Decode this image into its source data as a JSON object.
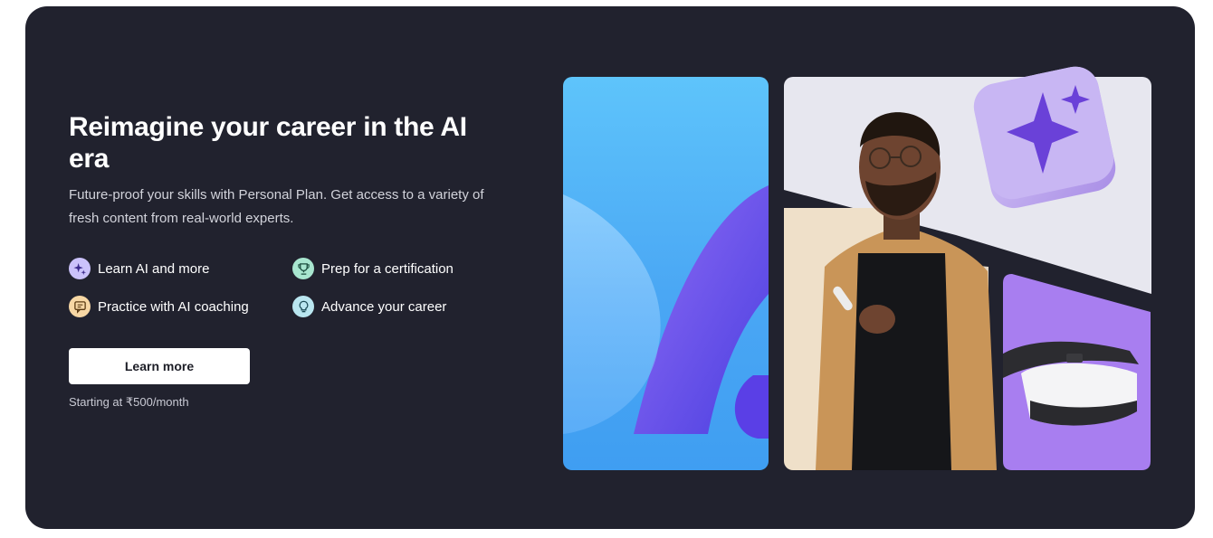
{
  "hero": {
    "title": "Reimagine your career in the AI era",
    "subtitle": "Future-proof your skills with Personal Plan. Get access to a variety of fresh content from real-world experts.",
    "features": [
      {
        "label": "Learn AI and more",
        "icon": "sparkle-icon",
        "color": "#cbc2fb"
      },
      {
        "label": "Prep for a certification",
        "icon": "trophy-icon",
        "color": "#a8e6cf"
      },
      {
        "label": "Practice with AI coaching",
        "icon": "chat-icon",
        "color": "#f7d7a4"
      },
      {
        "label": "Advance your career",
        "icon": "lightbulb-icon",
        "color": "#b9e6f0"
      }
    ],
    "cta_label": "Learn more",
    "price_note": "Starting at ₹500/month"
  },
  "colors": {
    "banner_bg": "#21222e",
    "accent_purple": "#a87ef0",
    "accent_blue": "#4aa7f4"
  }
}
